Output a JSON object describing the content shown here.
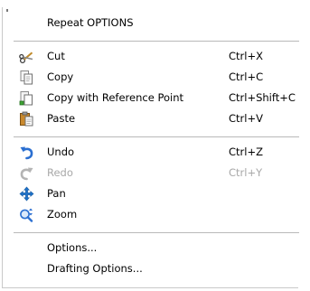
{
  "menu": {
    "repeat": "Repeat OPTIONS",
    "cut": {
      "label": "Cut",
      "shortcut": "Ctrl+X"
    },
    "copy": {
      "label": "Copy",
      "shortcut": "Ctrl+C"
    },
    "copy_ref": {
      "label": "Copy with Reference Point",
      "shortcut": "Ctrl+Shift+C"
    },
    "paste": {
      "label": "Paste",
      "shortcut": "Ctrl+V"
    },
    "undo": {
      "label": "Undo",
      "shortcut": "Ctrl+Z"
    },
    "redo": {
      "label": "Redo",
      "shortcut": "Ctrl+Y"
    },
    "pan": {
      "label": "Pan"
    },
    "zoom": {
      "label": "Zoom"
    },
    "options": {
      "label": "Options..."
    },
    "drafting_options": {
      "label": "Drafting Options..."
    }
  },
  "icons": {
    "cut": "scissors-icon",
    "copy": "copy-icon",
    "copy_ref": "copy-with-base-point-icon",
    "paste": "paste-icon",
    "undo": "undo-icon",
    "redo": "redo-icon",
    "pan": "pan-icon",
    "zoom": "zoom-icon"
  },
  "colors": {
    "undo_blue": "#2b6fd1",
    "disabled_gray": "#a8a8a8",
    "pan_blue": "#1f72c8"
  }
}
